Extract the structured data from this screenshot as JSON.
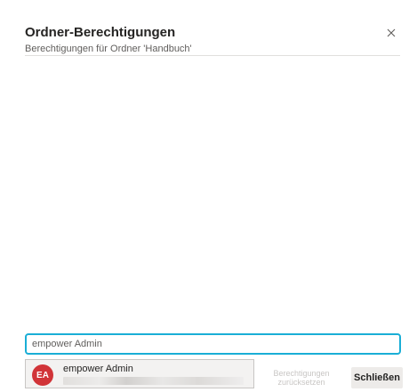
{
  "dialog": {
    "title": "Ordner-Berechtigungen",
    "subtitle": "Berechtigungen für Ordner 'Handbuch'"
  },
  "search": {
    "value": "empower Admin"
  },
  "suggestion": {
    "initials": "EA",
    "name": "empower Admin",
    "avatar_color": "#d13438"
  },
  "buttons": {
    "reset_label": "Berechtigungen zurücksetzen",
    "close_label": "Schließen"
  },
  "colors": {
    "accent": "#1aaed6"
  }
}
